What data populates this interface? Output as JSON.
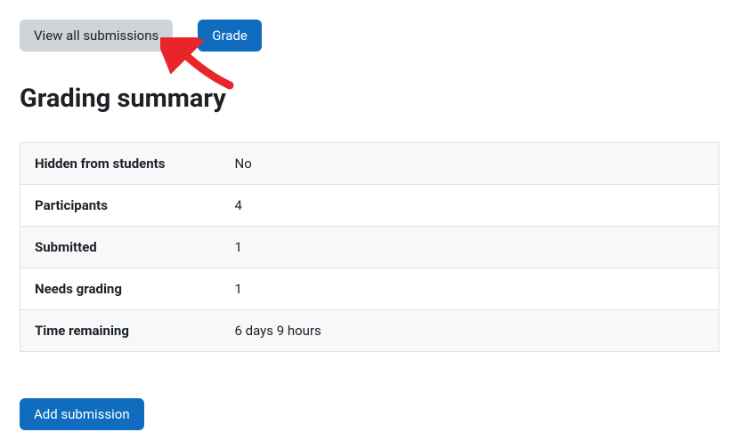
{
  "buttons": {
    "view_all": "View all submissions",
    "grade": "Grade",
    "add_submission": "Add submission"
  },
  "heading": "Grading summary",
  "summary": [
    {
      "label": "Hidden from students",
      "value": "No"
    },
    {
      "label": "Participants",
      "value": "4"
    },
    {
      "label": "Submitted",
      "value": "1"
    },
    {
      "label": "Needs grading",
      "value": "1"
    },
    {
      "label": "Time remaining",
      "value": "6 days 9 hours"
    }
  ],
  "annotation": {
    "arrow_color": "#e8252a"
  }
}
